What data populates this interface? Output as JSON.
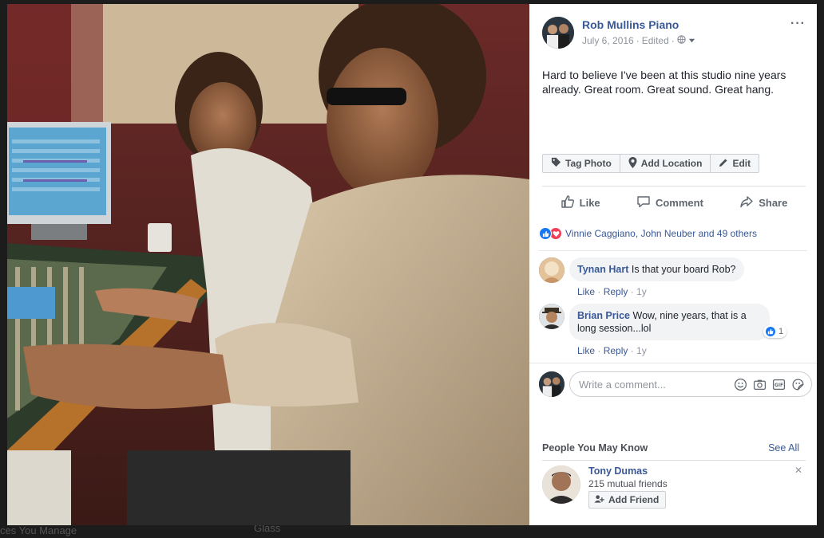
{
  "post": {
    "page_name": "Rob Mullins Piano",
    "date": "July 6, 2016",
    "edited": "Edited",
    "text": "Hard to believe I've been at this studio nine years already. Great room. Great sound. Great hang.",
    "photo_actions": [
      {
        "label": "Tag Photo",
        "icon": "tag-icon"
      },
      {
        "label": "Add Location",
        "icon": "location-pin-icon"
      },
      {
        "label": "Edit",
        "icon": "pencil-icon"
      }
    ]
  },
  "actions": {
    "like": "Like",
    "comment": "Comment",
    "share": "Share"
  },
  "reactions": {
    "summary": "Vinnie Caggiano, John Neuber and 49 others",
    "icons": [
      "like-icon",
      "love-icon"
    ]
  },
  "comments": [
    {
      "author": "Tynan Hart",
      "text": "Is that your board Rob?",
      "like": "Like",
      "reply": "Reply",
      "time": "1y"
    },
    {
      "author": "Brian Price",
      "text_line1": "Wow, nine years, that is a",
      "text_line2": "long session...lol",
      "like": "Like",
      "reply": "Reply",
      "time": "1y",
      "likes_count": "1"
    }
  ],
  "write_comment": {
    "placeholder": "Write a comment...",
    "icons": [
      "emoji-icon",
      "camera-icon",
      "gif-icon",
      "sticker-icon"
    ]
  },
  "pymk": {
    "title": "People You May Know",
    "see_all": "See All",
    "person": {
      "name": "Tony Dumas",
      "mutual": "215 mutual friends",
      "add_friend": "Add Friend"
    }
  },
  "background": {
    "left_text": "ces You Manage",
    "mid_text": "Glass"
  },
  "colors": {
    "link": "#385898",
    "like_blue": "#1877f2",
    "love_red": "#f33e58"
  }
}
